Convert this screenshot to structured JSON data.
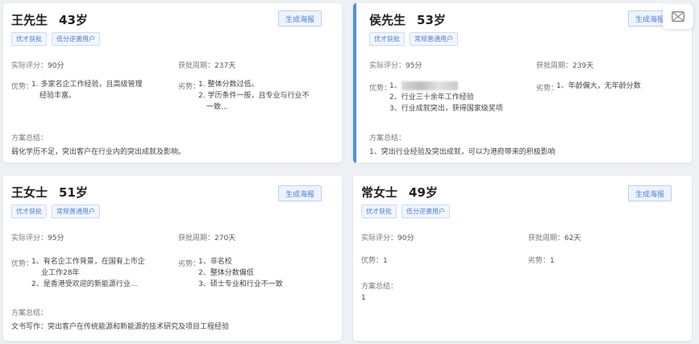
{
  "button_label": "生成海报",
  "labels": {
    "score": "实际评分：",
    "period": "获批周期：",
    "advantage": "优势：",
    "disadvantage": "劣势：",
    "summary": "方案总结："
  },
  "cards": [
    {
      "name": "王先生",
      "age": "43岁",
      "tags": [
        "优才获批",
        "低分逆袭用户"
      ],
      "score": "90分",
      "period": "237天",
      "advantages": [
        "1. 多家名企工作经验，且高级管理",
        "经验丰富。"
      ],
      "disadvantages": [
        "1. 整体分数过低。",
        "2. 学历条件一般，且专业与行业不",
        "一致..."
      ],
      "summary": "弱化学历不足，突出客户在行业内的突出成就及影响。"
    },
    {
      "name": "侯先生",
      "age": "53岁",
      "tags": [
        "优才获批",
        "常规普通用户"
      ],
      "score": "95分",
      "period": "239天",
      "advantages": [
        "1、",
        "2、行业三十余年工作经验",
        "3、行业成就突出，获得国家级奖项"
      ],
      "disadvantages": [
        "1、年龄偏大，无年龄分数"
      ],
      "summary": "1、突出行业经验及突出成就，可以为港府带来的积极影响"
    },
    {
      "name": "王女士",
      "age": "51岁",
      "tags": [
        "优才获批",
        "常规普通用户"
      ],
      "score": "95分",
      "period": "270天",
      "advantages": [
        "1、有名企工作背景，在国有上市企",
        "业工作28年",
        "2、是香港受欢迎的新能源行业..."
      ],
      "disadvantages": [
        "1、非名校",
        "2、整体分数偏低",
        "3、硕士专业和行业不一致"
      ],
      "summary": "文书写作：突出客户在传统能源和新能源的技术研究及项目工程经验"
    },
    {
      "name": "常女士",
      "age": "49岁",
      "tags": [
        "优才获批",
        "低分逆袭用户"
      ],
      "score": "90分",
      "period": "62天",
      "advantages": [
        "1"
      ],
      "disadvantages": [
        "1"
      ],
      "summary": "1"
    }
  ]
}
